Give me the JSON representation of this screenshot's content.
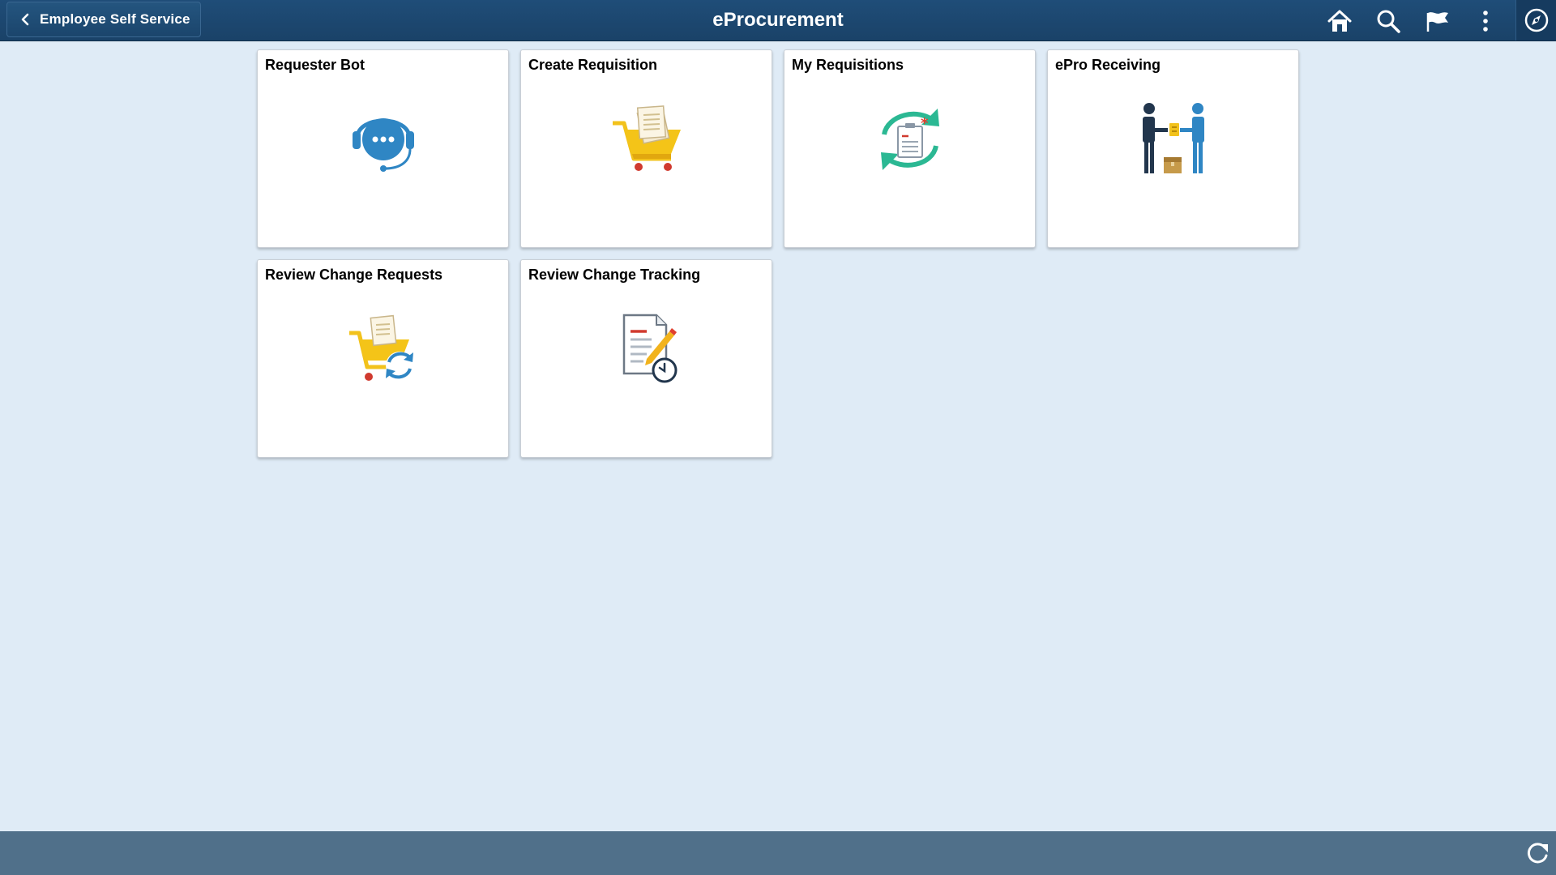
{
  "header": {
    "back_label": "Employee Self Service",
    "title": "eProcurement",
    "icons": [
      "home-icon",
      "search-icon",
      "flag-icon",
      "more-icon",
      "navbar-compass-icon"
    ],
    "colors": {
      "bar": "#1f4d78",
      "text": "#ffffff"
    }
  },
  "tiles": [
    {
      "title": "Requester Bot",
      "icon": "headset-chat-icon"
    },
    {
      "title": "Create Requisition",
      "icon": "shopping-cart-document-icon"
    },
    {
      "title": "My Requisitions",
      "icon": "document-refresh-cycle-icon"
    },
    {
      "title": "ePro Receiving",
      "icon": "people-handoff-package-icon"
    },
    {
      "title": "Review Change Requests",
      "icon": "cart-sync-icon"
    },
    {
      "title": "Review Change Tracking",
      "icon": "document-edit-clock-icon"
    }
  ],
  "footer": {
    "icon": "refresh-icon",
    "color": "#50708a"
  },
  "page": {
    "background": "#dfebf6"
  }
}
